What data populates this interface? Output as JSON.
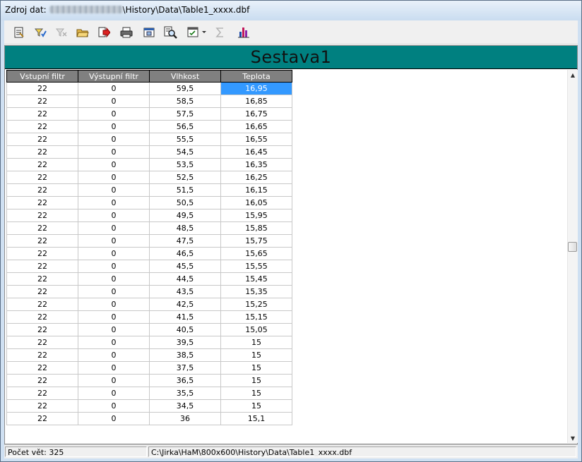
{
  "window": {
    "title_prefix": "Zdroj dat: ",
    "title_path": "\\History\\Data\\Table1_xxxx.dbf"
  },
  "toolbar": {
    "buttons": [
      {
        "icon": "report-properties-icon"
      },
      {
        "icon": "filter-icon"
      },
      {
        "icon": "clear-filter-icon"
      },
      {
        "icon": "open-folder-icon"
      },
      {
        "icon": "export-icon"
      },
      {
        "icon": "print-icon"
      },
      {
        "icon": "print-preview-icon"
      },
      {
        "icon": "find-icon"
      },
      {
        "icon": "columns-dropdown-icon"
      },
      {
        "icon": "sum-icon"
      },
      {
        "icon": "chart-icon"
      }
    ]
  },
  "report": {
    "title": "Sestava1",
    "accent_color": "#008080",
    "selection_color": "#3399ff",
    "columns": [
      "Vstupní filtr",
      "Výstupní filtr",
      "Vlhkost",
      "Teplota"
    ],
    "rows": [
      [
        "22",
        "0",
        "59,5",
        "16,95"
      ],
      [
        "22",
        "0",
        "58,5",
        "16,85"
      ],
      [
        "22",
        "0",
        "57,5",
        "16,75"
      ],
      [
        "22",
        "0",
        "56,5",
        "16,65"
      ],
      [
        "22",
        "0",
        "55,5",
        "16,55"
      ],
      [
        "22",
        "0",
        "54,5",
        "16,45"
      ],
      [
        "22",
        "0",
        "53,5",
        "16,35"
      ],
      [
        "22",
        "0",
        "52,5",
        "16,25"
      ],
      [
        "22",
        "0",
        "51,5",
        "16,15"
      ],
      [
        "22",
        "0",
        "50,5",
        "16,05"
      ],
      [
        "22",
        "0",
        "49,5",
        "15,95"
      ],
      [
        "22",
        "0",
        "48,5",
        "15,85"
      ],
      [
        "22",
        "0",
        "47,5",
        "15,75"
      ],
      [
        "22",
        "0",
        "46,5",
        "15,65"
      ],
      [
        "22",
        "0",
        "45,5",
        "15,55"
      ],
      [
        "22",
        "0",
        "44,5",
        "15,45"
      ],
      [
        "22",
        "0",
        "43,5",
        "15,35"
      ],
      [
        "22",
        "0",
        "42,5",
        "15,25"
      ],
      [
        "22",
        "0",
        "41,5",
        "15,15"
      ],
      [
        "22",
        "0",
        "40,5",
        "15,05"
      ],
      [
        "22",
        "0",
        "39,5",
        "15"
      ],
      [
        "22",
        "0",
        "38,5",
        "15"
      ],
      [
        "22",
        "0",
        "37,5",
        "15"
      ],
      [
        "22",
        "0",
        "36,5",
        "15"
      ],
      [
        "22",
        "0",
        "35,5",
        "15"
      ],
      [
        "22",
        "0",
        "34,5",
        "15"
      ],
      [
        "22",
        "0",
        "36",
        "15,1"
      ]
    ],
    "selected_cell": {
      "row": 0,
      "col": 3
    }
  },
  "status": {
    "record_count": "Počet vět: 325",
    "path": "C:\\Jirka\\HaM\\800x600\\History\\Data\\Table1_xxxx.dbf"
  }
}
